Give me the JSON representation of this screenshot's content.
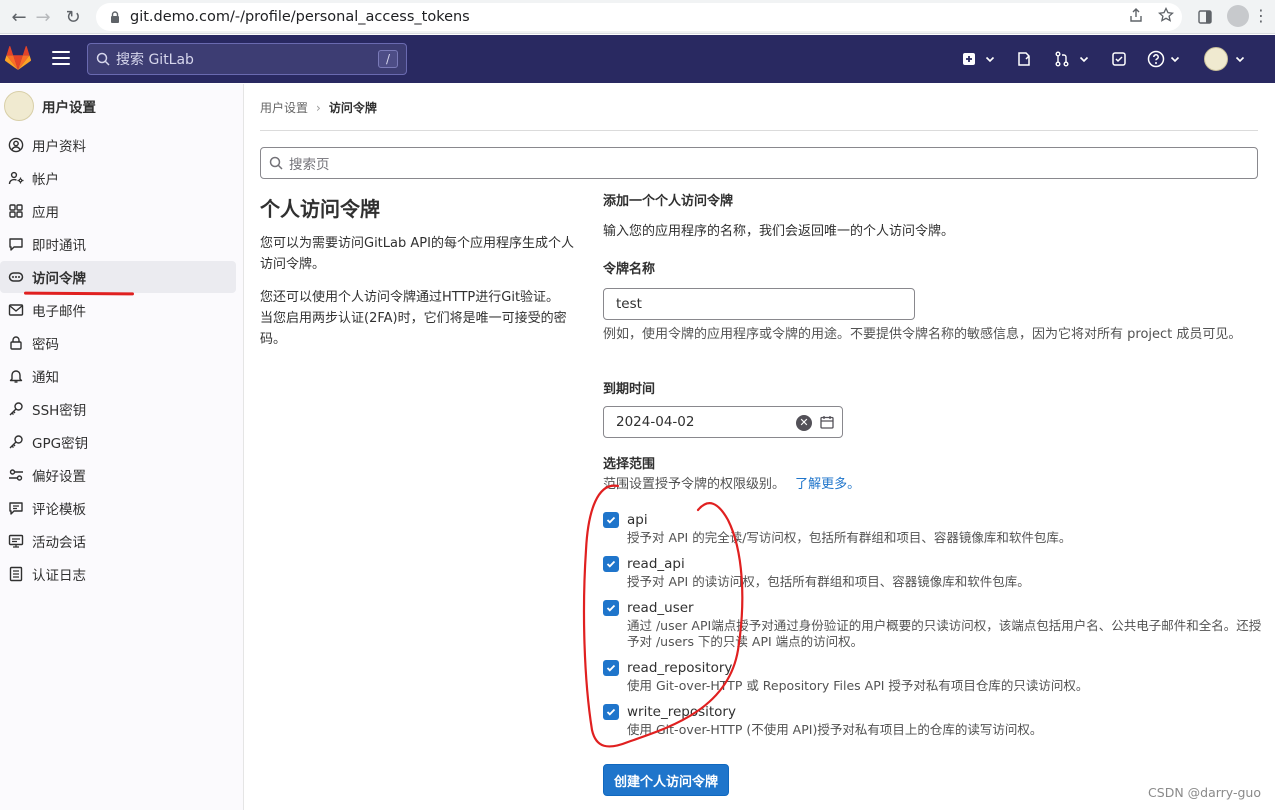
{
  "browser": {
    "url": "git.demo.com/-/profile/personal_access_tokens"
  },
  "header": {
    "search_placeholder": "搜索 GitLab",
    "search_shortcut": "/"
  },
  "sidebar": {
    "title": "用户设置",
    "items": [
      {
        "label": "用户资料",
        "icon": "user-icon"
      },
      {
        "label": "帐户",
        "icon": "account-icon"
      },
      {
        "label": "应用",
        "icon": "applications-icon"
      },
      {
        "label": "即时通讯",
        "icon": "chat-icon"
      },
      {
        "label": "访问令牌",
        "icon": "token-icon",
        "active": true
      },
      {
        "label": "电子邮件",
        "icon": "mail-icon"
      },
      {
        "label": "密码",
        "icon": "lock-icon"
      },
      {
        "label": "通知",
        "icon": "bell-icon"
      },
      {
        "label": "SSH密钥",
        "icon": "key-icon"
      },
      {
        "label": "GPG密钥",
        "icon": "key-icon"
      },
      {
        "label": "偏好设置",
        "icon": "preferences-icon"
      },
      {
        "label": "评论模板",
        "icon": "comment-icon"
      },
      {
        "label": "活动会话",
        "icon": "monitor-icon"
      },
      {
        "label": "认证日志",
        "icon": "log-icon"
      }
    ]
  },
  "breadcrumb": {
    "parent": "用户设置",
    "current": "访问令牌"
  },
  "page_search_placeholder": "搜索页",
  "left": {
    "title": "个人访问令牌",
    "para1": "您可以为需要访问GitLab API的每个应用程序生成个人访问令牌。",
    "para2": "您还可以使用个人访问令牌通过HTTP进行Git验证。 当您启用两步认证(2FA)时，它们将是唯一可接受的密码。"
  },
  "form": {
    "heading": "添加一个个人访问令牌",
    "intro": "输入您的应用程序的名称，我们会返回唯一的个人访问令牌。",
    "name_label": "令牌名称",
    "name_value": "test",
    "name_help": "例如，使用令牌的应用程序或令牌的用途。不要提供令牌名称的敏感信息，因为它将对所有 project 成员可见。",
    "expiry_label": "到期时间",
    "expiry_value": "2024-04-02",
    "scopes_label": "选择范围",
    "scopes_help": "范围设置授予令牌的权限级别。",
    "scopes_link": "了解更多。",
    "scopes": [
      {
        "name": "api",
        "checked": true,
        "desc": "授予对 API 的完全读/写访问权，包括所有群组和项目、容器镜像库和软件包库。"
      },
      {
        "name": "read_api",
        "checked": true,
        "desc": "授予对 API 的读访问权，包括所有群组和项目、容器镜像库和软件包库。"
      },
      {
        "name": "read_user",
        "checked": true,
        "desc": "通过 /user API端点授予对通过身份验证的用户概要的只读访问权，该端点包括用户名、公共电子邮件和全名。还授予对 /users 下的只读 API 端点的访问权。"
      },
      {
        "name": "read_repository",
        "checked": true,
        "desc": "使用 Git-over-HTTP 或 Repository Files API 授予对私有项目仓库的只读访问权。"
      },
      {
        "name": "write_repository",
        "checked": true,
        "desc": "使用 Git-over-HTTP (不使用 API)授予对私有项目上的仓库的读写访问权。"
      }
    ],
    "submit_label": "创建个人访问令牌"
  },
  "watermark": "CSDN @darry-guo",
  "colors": {
    "header_bg": "#292961",
    "primary": "#1f75cb",
    "annotation_red": "#e02020"
  }
}
